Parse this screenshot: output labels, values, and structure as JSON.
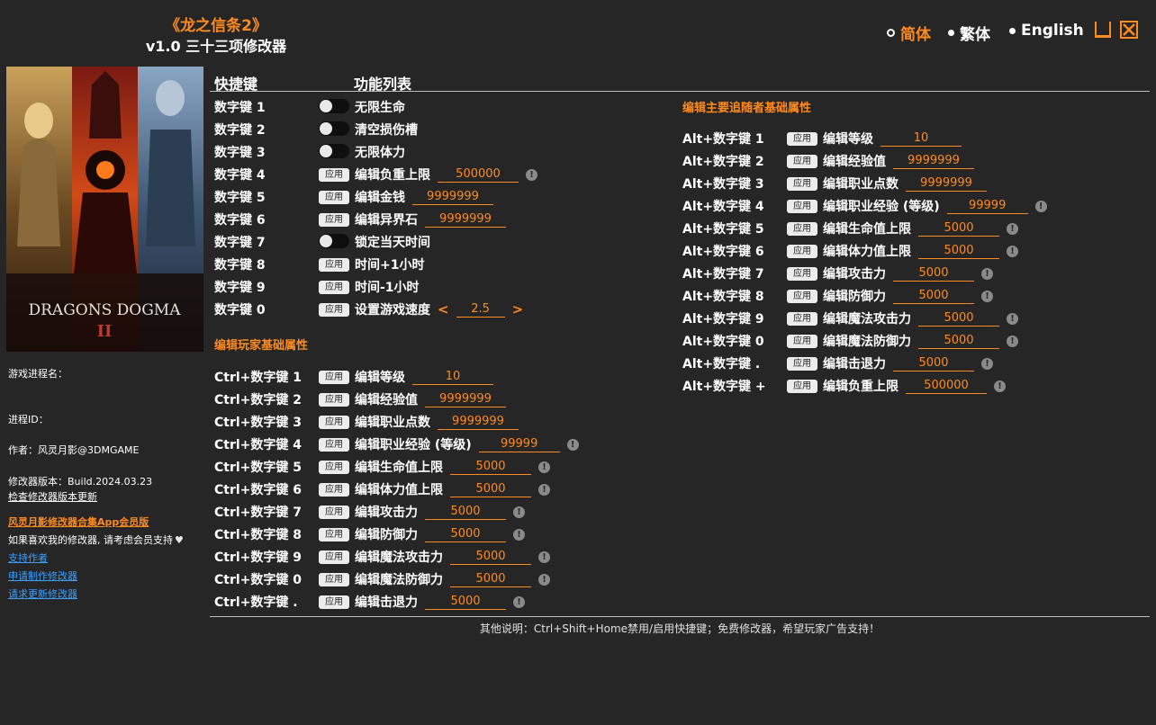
{
  "header": {
    "title": "《龙之信条2》",
    "subtitle": "v1.0 三十三项修改器",
    "languages": [
      "简体",
      "繁体",
      "English"
    ],
    "active_language": "简体"
  },
  "colors": {
    "accent": "#ff8a1f",
    "background": "#262626",
    "link": "#3ba0ff"
  },
  "sidebar": {
    "cover_text": "DRAGONS DOGMA",
    "cover_numeral": "II",
    "process_name_label": "游戏进程名：",
    "process_id_label": "进程ID：",
    "author": "作者：风灵月影@3DMGAME",
    "version": "修改器版本：Build.2024.03.23",
    "check_update": "检查修改器版本更新",
    "app_member": "风灵月影修改器合集App会员版",
    "support_text": "如果喜欢我的修改器, 请考虑会员支持",
    "links": [
      "支持作者",
      "申请制作修改器",
      "请求更新修改器"
    ]
  },
  "table": {
    "col_hotkey": "快捷键",
    "col_features": "功能列表"
  },
  "button_label": "应用",
  "section_player": "编辑玩家基础属性",
  "section_companion": "编辑主要追随者基础属性",
  "speed": {
    "left": "<",
    "right": ">"
  },
  "main_rows": [
    {
      "key": "数字键 1",
      "type": "toggle",
      "label": "无限生命"
    },
    {
      "key": "数字键 2",
      "type": "toggle",
      "label": "清空损伤槽"
    },
    {
      "key": "数字键 3",
      "type": "toggle",
      "label": "无限体力"
    },
    {
      "key": "数字键 4",
      "type": "apply",
      "label": "编辑负重上限",
      "value": "500000",
      "info": true
    },
    {
      "key": "数字键 5",
      "type": "apply",
      "label": "编辑金钱",
      "value": "9999999",
      "info": false
    },
    {
      "key": "数字键 6",
      "type": "apply",
      "label": "编辑异界石",
      "value": "9999999",
      "info": false
    },
    {
      "key": "数字键 7",
      "type": "toggle",
      "label": "锁定当天时间"
    },
    {
      "key": "数字键 8",
      "type": "apply",
      "label": "时间+1小时"
    },
    {
      "key": "数字键 9",
      "type": "apply",
      "label": "时间-1小时"
    },
    {
      "key": "数字键 0",
      "type": "speed",
      "label": "设置游戏速度",
      "value": "2.5"
    }
  ],
  "player_rows": [
    {
      "key": "Ctrl+数字键 1",
      "label": "编辑等级",
      "value": "10",
      "info": false
    },
    {
      "key": "Ctrl+数字键 2",
      "label": "编辑经验值",
      "value": "9999999",
      "info": false
    },
    {
      "key": "Ctrl+数字键 3",
      "label": "编辑职业点数",
      "value": "9999999",
      "info": false
    },
    {
      "key": "Ctrl+数字键 4",
      "label": "编辑职业经验 (等级)",
      "value": "99999",
      "info": true
    },
    {
      "key": "Ctrl+数字键 5",
      "label": "编辑生命值上限",
      "value": "5000",
      "info": true
    },
    {
      "key": "Ctrl+数字键 6",
      "label": "编辑体力值上限",
      "value": "5000",
      "info": true
    },
    {
      "key": "Ctrl+数字键 7",
      "label": "编辑攻击力",
      "value": "5000",
      "info": true
    },
    {
      "key": "Ctrl+数字键 8",
      "label": "编辑防御力",
      "value": "5000",
      "info": true
    },
    {
      "key": "Ctrl+数字键 9",
      "label": "编辑魔法攻击力",
      "value": "5000",
      "info": true
    },
    {
      "key": "Ctrl+数字键 0",
      "label": "编辑魔法防御力",
      "value": "5000",
      "info": true
    },
    {
      "key": "Ctrl+数字键 .",
      "label": "编辑击退力",
      "value": "5000",
      "info": true
    }
  ],
  "companion_rows": [
    {
      "key": "Alt+数字键 1",
      "label": "编辑等级",
      "value": "10",
      "info": false
    },
    {
      "key": "Alt+数字键 2",
      "label": "编辑经验值",
      "value": "9999999",
      "info": false
    },
    {
      "key": "Alt+数字键 3",
      "label": "编辑职业点数",
      "value": "9999999",
      "info": false
    },
    {
      "key": "Alt+数字键 4",
      "label": "编辑职业经验 (等级)",
      "value": "99999",
      "info": true
    },
    {
      "key": "Alt+数字键 5",
      "label": "编辑生命值上限",
      "value": "5000",
      "info": true
    },
    {
      "key": "Alt+数字键 6",
      "label": "编辑体力值上限",
      "value": "5000",
      "info": true
    },
    {
      "key": "Alt+数字键 7",
      "label": "编辑攻击力",
      "value": "5000",
      "info": true
    },
    {
      "key": "Alt+数字键 8",
      "label": "编辑防御力",
      "value": "5000",
      "info": true
    },
    {
      "key": "Alt+数字键 9",
      "label": "编辑魔法攻击力",
      "value": "5000",
      "info": true
    },
    {
      "key": "Alt+数字键 0",
      "label": "编辑魔法防御力",
      "value": "5000",
      "info": true
    },
    {
      "key": "Alt+数字键 .",
      "label": "编辑击退力",
      "value": "5000",
      "info": true
    },
    {
      "key": "Alt+数字键 +",
      "label": "编辑负重上限",
      "value": "500000",
      "info": true
    }
  ],
  "footer": "其他说明：Ctrl+Shift+Home禁用/启用快捷键；免费修改器，希望玩家广告支持！"
}
